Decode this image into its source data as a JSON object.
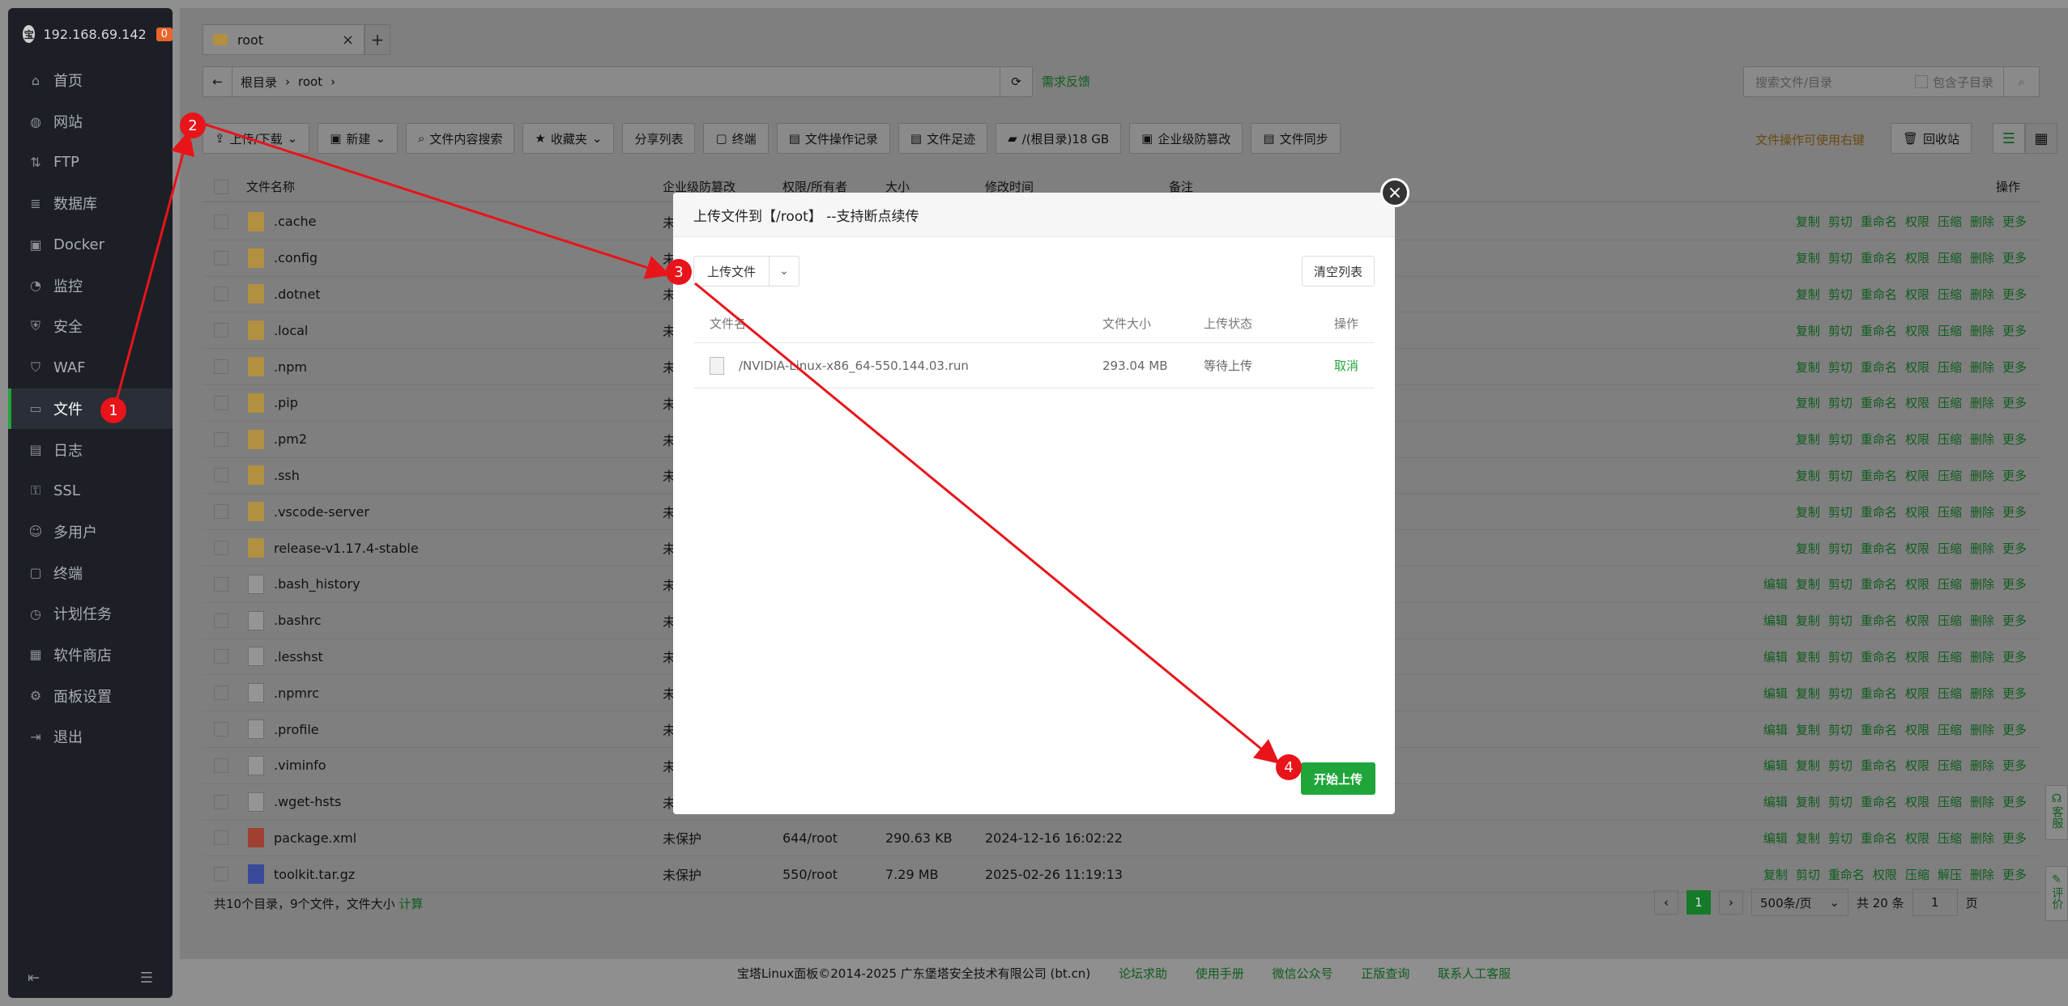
{
  "sidebar": {
    "ip": "192.168.69.142",
    "badge": "0",
    "items": [
      {
        "label": "首页",
        "icon": "home-icon"
      },
      {
        "label": "网站",
        "icon": "globe-icon"
      },
      {
        "label": "FTP",
        "icon": "ftp-icon"
      },
      {
        "label": "数据库",
        "icon": "database-icon"
      },
      {
        "label": "Docker",
        "icon": "docker-icon"
      },
      {
        "label": "监控",
        "icon": "monitor-icon"
      },
      {
        "label": "安全",
        "icon": "shield-icon"
      },
      {
        "label": "WAF",
        "icon": "waf-icon"
      },
      {
        "label": "文件",
        "icon": "folder-icon"
      },
      {
        "label": "日志",
        "icon": "log-icon"
      },
      {
        "label": "SSL",
        "icon": "ssl-icon"
      },
      {
        "label": "多用户",
        "icon": "users-icon"
      },
      {
        "label": "终端",
        "icon": "terminal-icon"
      },
      {
        "label": "计划任务",
        "icon": "clock-icon"
      },
      {
        "label": "软件商店",
        "icon": "store-icon"
      },
      {
        "label": "面板设置",
        "icon": "gear-icon"
      },
      {
        "label": "退出",
        "icon": "logout-icon"
      }
    ],
    "active_index": 8
  },
  "tabs": [
    {
      "label": "root"
    }
  ],
  "path": {
    "crumbs": [
      "根目录",
      "root"
    ]
  },
  "feedback": "需求反馈",
  "search": {
    "placeholder": "搜索文件/目录",
    "subdir_label": "包含子目录"
  },
  "toolbar": {
    "buttons": [
      "上传/下载",
      "新建",
      "文件内容搜索",
      "收藏夹",
      "分享列表",
      "终端",
      "文件操作记录",
      "文件足迹",
      "/(根目录)18 GB",
      "企业级防篡改",
      "文件同步"
    ],
    "tip": "文件操作可使用右键",
    "recycle": "回收站"
  },
  "table": {
    "headers": {
      "name": "文件名称",
      "protect": "企业级防篡改",
      "perm": "权限/所有者",
      "size": "大小",
      "mtime": "修改时间",
      "note": "备注",
      "ops": "操作"
    },
    "rows": [
      {
        "name": ".cache",
        "type": "folder",
        "protect": "未",
        "perm": "",
        "size": "",
        "time": ""
      },
      {
        "name": ".config",
        "type": "folder",
        "protect": "未",
        "perm": "",
        "size": "",
        "time": ""
      },
      {
        "name": ".dotnet",
        "type": "folder",
        "protect": "未",
        "perm": "",
        "size": "",
        "time": ""
      },
      {
        "name": ".local",
        "type": "folder",
        "protect": "未",
        "perm": "",
        "size": "",
        "time": ""
      },
      {
        "name": ".npm",
        "type": "folder",
        "protect": "未",
        "perm": "",
        "size": "",
        "time": ""
      },
      {
        "name": ".pip",
        "type": "folder",
        "protect": "未",
        "perm": "",
        "size": "",
        "time": ""
      },
      {
        "name": ".pm2",
        "type": "folder",
        "protect": "未",
        "perm": "",
        "size": "",
        "time": ""
      },
      {
        "name": ".ssh",
        "type": "folder",
        "protect": "未",
        "perm": "",
        "size": "",
        "time": ""
      },
      {
        "name": ".vscode-server",
        "type": "folder",
        "protect": "未",
        "perm": "",
        "size": "",
        "time": ""
      },
      {
        "name": "release-v1.17.4-stable",
        "type": "folder",
        "protect": "未",
        "perm": "",
        "size": "",
        "time": ""
      },
      {
        "name": ".bash_history",
        "type": "file",
        "protect": "未",
        "perm": "",
        "size": "",
        "time": ""
      },
      {
        "name": ".bashrc",
        "type": "file",
        "protect": "未",
        "perm": "",
        "size": "",
        "time": ""
      },
      {
        "name": ".lesshst",
        "type": "file",
        "protect": "未",
        "perm": "",
        "size": "",
        "time": ""
      },
      {
        "name": ".npmrc",
        "type": "file",
        "protect": "未",
        "perm": "",
        "size": "",
        "time": ""
      },
      {
        "name": ".profile",
        "type": "file",
        "protect": "未",
        "perm": "",
        "size": "",
        "time": ""
      },
      {
        "name": ".viminfo",
        "type": "file",
        "protect": "未",
        "perm": "",
        "size": "",
        "time": ""
      },
      {
        "name": ".wget-hsts",
        "type": "file",
        "protect": "未",
        "perm": "",
        "size": "",
        "time": ""
      },
      {
        "name": "package.xml",
        "type": "xml",
        "protect": "未保护",
        "perm": "644/root",
        "size": "290.63 KB",
        "time": "2024-12-16 16:02:22"
      },
      {
        "name": "toolkit.tar.gz",
        "type": "gz",
        "protect": "未保护",
        "perm": "550/root",
        "size": "7.29 MB",
        "time": "2025-02-26 11:19:13"
      }
    ],
    "folder_ops": [
      "复制",
      "剪切",
      "重命名",
      "权限",
      "压缩",
      "删除",
      "更多"
    ],
    "file_ops": [
      "编辑",
      "复制",
      "剪切",
      "重命名",
      "权限",
      "压缩",
      "删除",
      "更多"
    ],
    "gz_ops": [
      "复制",
      "剪切",
      "重命名",
      "权限",
      "压缩",
      "解压",
      "删除",
      "更多"
    ]
  },
  "summary": {
    "text": "共10个目录，9个文件，文件大小",
    "link": "计算"
  },
  "pager": {
    "current": "1",
    "per_page": "500条/页",
    "total": "共 20 条",
    "goto": "1",
    "page_unit": "页"
  },
  "side_help": {
    "service": "客服",
    "review": "评价"
  },
  "copyright": {
    "text": "宝塔Linux面板©2014-2025 广东堡塔安全技术有限公司 (bt.cn)",
    "links": [
      "论坛求助",
      "使用手册",
      "微信公众号",
      "正版查询",
      "联系人工客服"
    ]
  },
  "modal": {
    "title": "上传文件到【/root】 --支持断点续传",
    "upload_label": "上传文件",
    "clear_label": "清空列表",
    "headers": [
      "文件名",
      "文件大小",
      "上传状态",
      "操作"
    ],
    "file": {
      "name": "/NVIDIA-Linux-x86_64-550.144.03.run",
      "size": "293.04 MB",
      "status": "等待上传",
      "action": "取消"
    },
    "start_label": "开始上传"
  },
  "annotations": {
    "markers": [
      "1",
      "2",
      "3",
      "4"
    ],
    "color": "#e8141a"
  }
}
